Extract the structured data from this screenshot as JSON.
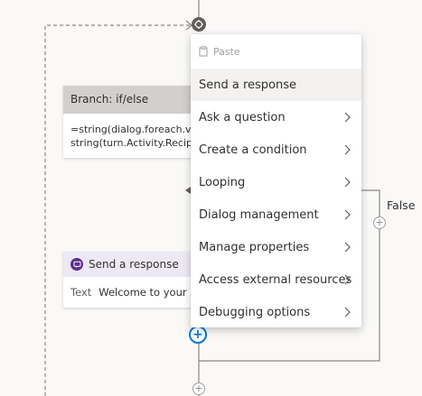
{
  "branch": {
    "title": "Branch: if/else",
    "line1": "=string(dialog.foreach.val",
    "line2": "string(turn.Activity.Recipie"
  },
  "send_card": {
    "title": "Send a response",
    "field_label": "Text",
    "field_value": "Welcome to your bo"
  },
  "false_label": "False",
  "menu": {
    "paste_label": "Paste",
    "items": [
      {
        "label": "Send a response",
        "submenu": false
      },
      {
        "label": "Ask a question",
        "submenu": true
      },
      {
        "label": "Create a condition",
        "submenu": true
      },
      {
        "label": "Looping",
        "submenu": true
      },
      {
        "label": "Dialog management",
        "submenu": true
      },
      {
        "label": "Manage properties",
        "submenu": true
      },
      {
        "label": "Access external resources",
        "submenu": true
      },
      {
        "label": "Debugging options",
        "submenu": true
      }
    ]
  },
  "plus_glyph": "+",
  "colors": {
    "accent": "#0078d4",
    "send_icon": "#5c2d91",
    "branch_header": "#d2d0ce",
    "send_header": "#ede9f4",
    "connector": "#605e5c"
  }
}
